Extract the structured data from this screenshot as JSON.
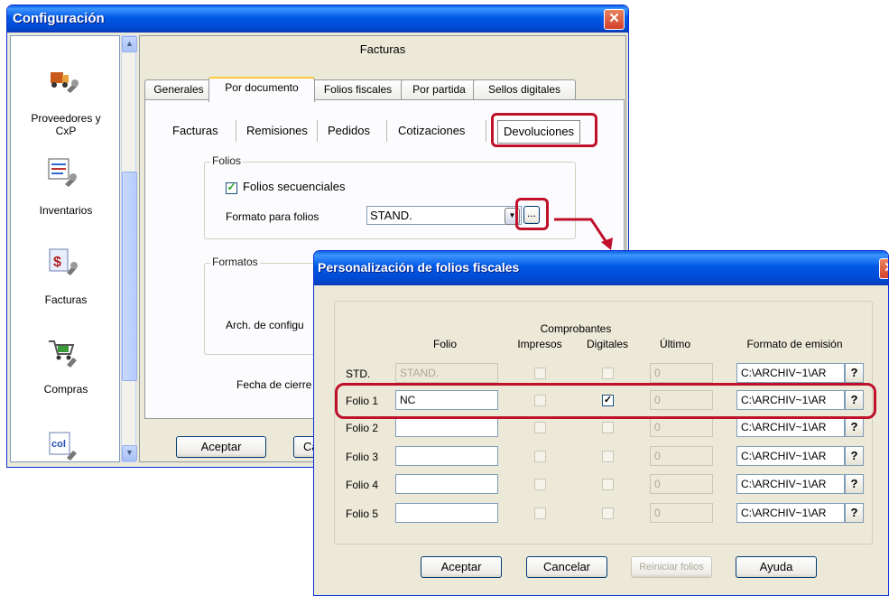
{
  "config_window": {
    "title": "Configuración",
    "sidebar": [
      {
        "label": "Proveedores y\nCxP",
        "icon": "truck-wrench-icon"
      },
      {
        "label": "Inventarios",
        "icon": "inventory-wrench-icon"
      },
      {
        "label": "Facturas",
        "icon": "invoice-wrench-icon"
      },
      {
        "label": "Compras",
        "icon": "cart-wrench-icon"
      },
      {
        "label": "",
        "icon": "quotation-wrench-icon"
      }
    ],
    "pane_title": "Facturas",
    "tabs": [
      "Generales",
      "Por documento",
      "Folios fiscales",
      "Por partida",
      "Sellos digitales"
    ],
    "active_tab": "Por documento",
    "subtabs": [
      "Facturas",
      "Remisiones",
      "Pedidos",
      "Cotizaciones",
      "Devoluciones"
    ],
    "active_subtab": "Devoluciones",
    "folios_group": "Folios",
    "folios_secuenciales": {
      "label": "Folios secuenciales",
      "checked": true
    },
    "formato_label": "Formato para folios",
    "formato_value": "STAND.",
    "browse_button": "...",
    "formatos_group": "Formatos",
    "arch_label": "Arch. de configu",
    "fecha_label": "Fecha de cierre",
    "buttons": {
      "aceptar": "Aceptar",
      "cancelar_partial": "Ca"
    }
  },
  "dialog": {
    "title": "Personalización de folios fiscales",
    "headers": {
      "folio": "Folio",
      "comprobantes": "Comprobantes",
      "impresos": "Impresos",
      "digitales": "Digitales",
      "ultimo": "Último",
      "formato": "Formato de emisión"
    },
    "rows": [
      {
        "label": "STD.",
        "folio": "STAND.",
        "folio_disabled": true,
        "impresos": false,
        "digitales": false,
        "ultimo": "0",
        "formato": "C:\\ARCHIV~1\\AR"
      },
      {
        "label": "Folio 1",
        "folio": "NC",
        "folio_disabled": false,
        "impresos": false,
        "digitales": true,
        "ultimo": "0",
        "formato": "C:\\ARCHIV~1\\AR"
      },
      {
        "label": "Folio 2",
        "folio": "",
        "folio_disabled": false,
        "impresos": false,
        "digitales": false,
        "ultimo": "0",
        "formato": "C:\\ARCHIV~1\\AR"
      },
      {
        "label": "Folio 3",
        "folio": "",
        "folio_disabled": false,
        "impresos": false,
        "digitales": false,
        "ultimo": "0",
        "formato": "C:\\ARCHIV~1\\AR"
      },
      {
        "label": "Folio 4",
        "folio": "",
        "folio_disabled": false,
        "impresos": false,
        "digitales": false,
        "ultimo": "0",
        "formato": "C:\\ARCHIV~1\\AR"
      },
      {
        "label": "Folio 5",
        "folio": "",
        "folio_disabled": false,
        "impresos": false,
        "digitales": false,
        "ultimo": "0",
        "formato": "C:\\ARCHIV~1\\AR"
      }
    ],
    "help_glyph": "?",
    "buttons": {
      "aceptar": "Aceptar",
      "cancelar": "Cancelar",
      "reiniciar": "Reiniciar folios",
      "ayuda": "Ayuda"
    }
  },
  "colors": {
    "highlight": "#c0102a",
    "titlebar": "#0054e3"
  }
}
